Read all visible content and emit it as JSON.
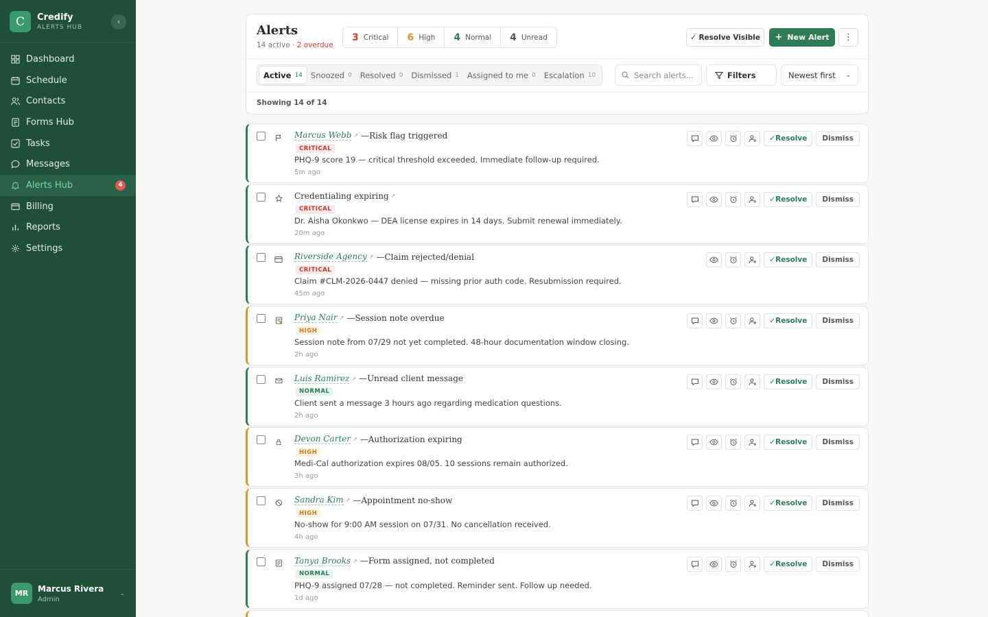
{
  "brand": {
    "logo_letter": "C",
    "name": "Credify",
    "subtitle": "ALERTS HUB",
    "collapse_icon": "chevron-left-icon"
  },
  "nav": [
    {
      "label": "Dashboard",
      "icon": "grid-icon",
      "active": false
    },
    {
      "label": "Schedule",
      "icon": "calendar-icon",
      "active": false
    },
    {
      "label": "Contacts",
      "icon": "users-icon",
      "active": false
    },
    {
      "label": "Forms Hub",
      "icon": "document-icon",
      "active": false
    },
    {
      "label": "Tasks",
      "icon": "checkbox-icon",
      "active": false
    },
    {
      "label": "Messages",
      "icon": "chat-icon",
      "active": false
    },
    {
      "label": "Alerts Hub",
      "icon": "bell-icon",
      "active": true,
      "badge": "4"
    },
    {
      "label": "Billing",
      "icon": "card-icon",
      "active": false
    },
    {
      "label": "Reports",
      "icon": "bar-chart-icon",
      "active": false
    },
    {
      "label": "Settings",
      "icon": "gear-icon",
      "active": false
    }
  ],
  "user": {
    "initials": "MR",
    "name": "Marcus Rivera",
    "role": "Admin"
  },
  "header": {
    "title": "Alerts",
    "summary": "14 active · ",
    "overdue": "2 overdue",
    "stats": [
      {
        "count": "3",
        "label": "Critical",
        "color": "#d33a2c"
      },
      {
        "count": "6",
        "label": "High",
        "color": "#e0922e"
      },
      {
        "count": "4",
        "label": "Normal",
        "color": "#2e7d57"
      },
      {
        "count": "4",
        "label": "Unread",
        "color": "#555555"
      }
    ],
    "resolve_visible": "✓ Resolve Visible",
    "new_alert": "New Alert",
    "more": "⋮"
  },
  "tabs": [
    {
      "label": "Active",
      "count": "14",
      "active": true
    },
    {
      "label": "Snoozed",
      "count": "0",
      "active": false
    },
    {
      "label": "Resolved",
      "count": "0",
      "active": false
    },
    {
      "label": "Dismissed",
      "count": "1",
      "active": false
    },
    {
      "label": "Assigned to me",
      "count": "0",
      "active": false
    },
    {
      "label": "Escalation",
      "count": "10",
      "active": false
    }
  ],
  "search": {
    "placeholder": "Search alerts..."
  },
  "filters_label": "Filters",
  "sort_label": "Newest first",
  "showing": "Showing 14 of 14",
  "actions": {
    "resolve": "✓Resolve",
    "dismiss": "Dismiss"
  },
  "alerts": [
    {
      "icon": "flag-icon",
      "name": "Marcus Webb",
      "title": "Risk flag triggered",
      "severity": "CRITICAL",
      "level": "critical",
      "desc": "PHQ-9 score 19 — critical threshold exceeded. Immediate follow-up required.",
      "time": "5m ago",
      "has_message": true
    },
    {
      "icon": "star-icon",
      "name": "",
      "title": "Credentialing expiring",
      "severity": "CRITICAL",
      "level": "critical",
      "desc": "Dr. Aisha Okonkwo — DEA license expires in 14 days. Submit renewal immediately.",
      "time": "20m ago",
      "has_message": true
    },
    {
      "icon": "card-icon",
      "name": "Riverside Agency",
      "title": "Claim rejected/denial",
      "severity": "CRITICAL",
      "level": "critical",
      "desc": "Claim #CLM-2026-0447 denied — missing prior auth code. Resubmission required.",
      "time": "45m ago",
      "has_message": false
    },
    {
      "icon": "note-icon",
      "name": "Priya Nair",
      "title": "Session note overdue",
      "severity": "HIGH",
      "level": "high",
      "desc": "Session note from 07/29 not yet completed. 48-hour documentation window closing.",
      "time": "2h ago",
      "has_message": true
    },
    {
      "icon": "mail-icon",
      "name": "Luis Ramirez",
      "title": "Unread client message",
      "severity": "NORMAL",
      "level": "normal",
      "desc": "Client sent a message 3 hours ago regarding medication questions.",
      "time": "2h ago",
      "has_message": true
    },
    {
      "icon": "lock-icon",
      "name": "Devon Carter",
      "title": "Authorization expiring",
      "severity": "HIGH",
      "level": "high",
      "desc": "Medi-Cal authorization expires 08/05. 10 sessions remain authorized.",
      "time": "3h ago",
      "has_message": true
    },
    {
      "icon": "no-show-icon",
      "name": "Sandra Kim",
      "title": "Appointment no-show",
      "severity": "HIGH",
      "level": "high",
      "desc": "No-show for 9:00 AM session on 07/31. No cancellation received.",
      "time": "4h ago",
      "has_message": true
    },
    {
      "icon": "form-icon",
      "name": "Tanya Brooks",
      "title": "Form assigned, not completed",
      "severity": "NORMAL",
      "level": "normal",
      "desc": "PHQ-9 assigned 07/28 — not completed. Reminder sent. Follow up needed.",
      "time": "1d ago",
      "has_message": true
    }
  ]
}
